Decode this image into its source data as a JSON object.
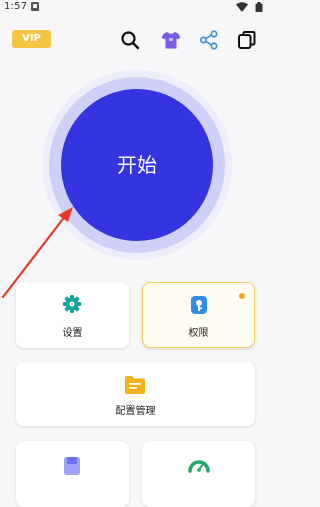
{
  "status_bar": {
    "time": "1:57"
  },
  "header": {
    "vip_label": "VIP"
  },
  "main": {
    "start_label": "开始"
  },
  "cards": {
    "settings_label": "设置",
    "permissions_label": "权限",
    "config_label": "配置管理"
  },
  "colors": {
    "accent": "#3434e0",
    "vip": "#f6c543",
    "teal": "#15a3a0",
    "arrow": "#e23b2e"
  }
}
